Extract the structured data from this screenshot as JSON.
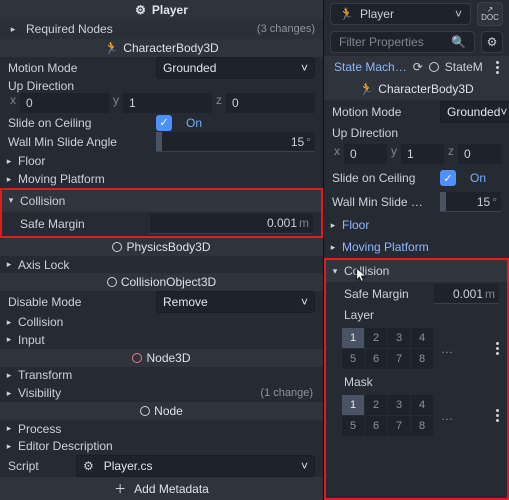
{
  "left": {
    "title": "Player",
    "required_nodes": {
      "label": "Required Nodes",
      "changes": "(3 changes)"
    },
    "class_cb3d": "CharacterBody3D",
    "motion_mode": {
      "label": "Motion Mode",
      "value": "Grounded"
    },
    "up_direction": {
      "label": "Up Direction",
      "x": "0",
      "y": "1",
      "z": "0"
    },
    "slide_on_ceiling": {
      "label": "Slide on Ceiling",
      "value": "On"
    },
    "wall_min_slide": {
      "label": "Wall Min Slide Angle",
      "value": "15",
      "unit": "°"
    },
    "floor": "Floor",
    "moving_platform": "Moving Platform",
    "collision": {
      "label": "Collision",
      "safe_margin_label": "Safe Margin",
      "safe_margin_value": "0.001",
      "unit": "m"
    },
    "physicsbody3d": "PhysicsBody3D",
    "axis_lock": "Axis Lock",
    "collisionobject3d": "CollisionObject3D",
    "disable_mode": {
      "label": "Disable Mode",
      "value": "Remove"
    },
    "collision2": "Collision",
    "input": "Input",
    "node3d": "Node3D",
    "transform": "Transform",
    "visibility": {
      "label": "Visibility",
      "changes": "(1 change)"
    },
    "node": "Node",
    "process": "Process",
    "editor_desc": "Editor Description",
    "script": {
      "label": "Script",
      "value": "Player.cs"
    },
    "add_metadata": "Add Metadata"
  },
  "right": {
    "title": "Player",
    "doc": "DOC",
    "filter_placeholder": "Filter Properties",
    "state_machine_crumb": "State Mach…",
    "state_m": "StateM",
    "class_cb3d": "CharacterBody3D",
    "motion_mode": {
      "label": "Motion Mode",
      "value": "Grounded"
    },
    "up_direction": {
      "label": "Up Direction",
      "x": "0",
      "y": "1",
      "z": "0"
    },
    "slide_on_ceiling": {
      "label": "Slide on Ceiling",
      "value": "On"
    },
    "wall_min_slide": {
      "label": "Wall Min Slide …",
      "value": "15",
      "unit": "°"
    },
    "floor": "Floor",
    "moving_platform": "Moving Platform",
    "collision": {
      "label": "Collision",
      "safe_margin_label": "Safe Margin",
      "safe_margin_value": "0.001",
      "unit": "m"
    },
    "layer_label": "Layer",
    "mask_label": "Mask",
    "layer_cells": [
      "1",
      "2",
      "3",
      "4",
      "5",
      "6",
      "7",
      "8"
    ],
    "mask_cells": [
      "1",
      "2",
      "3",
      "4",
      "5",
      "6",
      "7",
      "8"
    ]
  },
  "axes": {
    "x": "x",
    "y": "y",
    "z": "z"
  }
}
